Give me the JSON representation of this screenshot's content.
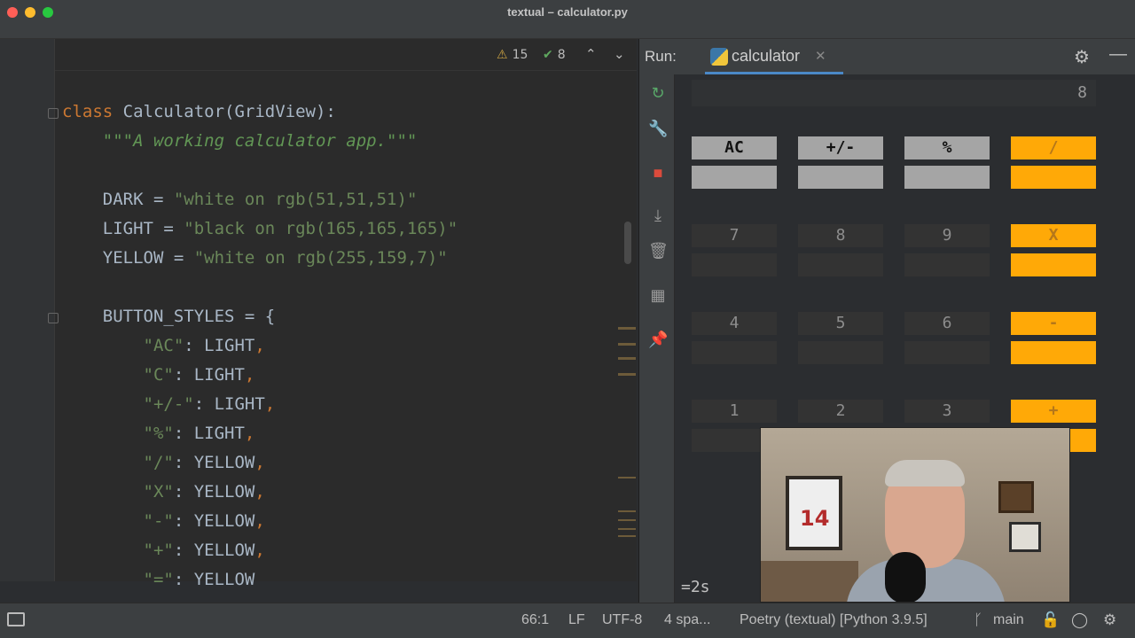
{
  "window": {
    "title": "textual – calculator.py"
  },
  "editor": {
    "inspection": {
      "warnings": "15",
      "weak_warnings": "8"
    },
    "code": [
      {
        "parts": [
          [
            "kw",
            "class "
          ],
          [
            "cls",
            "Calculator(GridView):"
          ]
        ]
      },
      {
        "parts": [
          [
            "doc",
            "    \"\"\"A working calculator app.\"\"\""
          ]
        ]
      },
      {
        "parts": []
      },
      {
        "parts": [
          [
            "cls",
            "    DARK = "
          ],
          [
            "str",
            "\"white on rgb(51,51,51)\""
          ]
        ]
      },
      {
        "parts": [
          [
            "cls",
            "    LIGHT = "
          ],
          [
            "str",
            "\"black on rgb(165,165,165)\""
          ]
        ]
      },
      {
        "parts": [
          [
            "cls",
            "    YELLOW = "
          ],
          [
            "str",
            "\"white on rgb(255,159,7)\""
          ]
        ]
      },
      {
        "parts": []
      },
      {
        "parts": [
          [
            "cls",
            "    BUTTON_STYLES = {"
          ]
        ]
      },
      {
        "parts": [
          [
            "str",
            "        \"AC\""
          ],
          [
            "cls",
            ": LIGHT"
          ],
          [
            "kw",
            ","
          ]
        ]
      },
      {
        "parts": [
          [
            "str",
            "        \"C\""
          ],
          [
            "cls",
            ": LIGHT"
          ],
          [
            "kw",
            ","
          ]
        ]
      },
      {
        "parts": [
          [
            "str",
            "        \"+/-\""
          ],
          [
            "cls",
            ": LIGHT"
          ],
          [
            "kw",
            ","
          ]
        ]
      },
      {
        "parts": [
          [
            "str",
            "        \"%\""
          ],
          [
            "cls",
            ": LIGHT"
          ],
          [
            "kw",
            ","
          ]
        ]
      },
      {
        "parts": [
          [
            "str",
            "        \"/\""
          ],
          [
            "cls",
            ": YELLOW"
          ],
          [
            "kw",
            ","
          ]
        ]
      },
      {
        "parts": [
          [
            "str",
            "        \"X\""
          ],
          [
            "cls",
            ": YELLOW"
          ],
          [
            "kw",
            ","
          ]
        ]
      },
      {
        "parts": [
          [
            "str",
            "        \"-\""
          ],
          [
            "cls",
            ": YELLOW"
          ],
          [
            "kw",
            ","
          ]
        ]
      },
      {
        "parts": [
          [
            "str",
            "        \"+\""
          ],
          [
            "cls",
            ": YELLOW"
          ],
          [
            "kw",
            ","
          ]
        ]
      },
      {
        "parts": [
          [
            "str",
            "        \"=\""
          ],
          [
            "cls",
            ": YELLOW"
          ]
        ]
      }
    ]
  },
  "run_panel": {
    "label": "Run:",
    "tab_name": "calculator",
    "display_value": "8",
    "elapsed": "=2s",
    "rows": [
      [
        {
          "label": "AC",
          "style": "light"
        },
        {
          "label": "+/-",
          "style": "light"
        },
        {
          "label": "%",
          "style": "light"
        },
        {
          "label": "/",
          "style": "yellow"
        }
      ],
      [
        {
          "label": "7",
          "style": "dark"
        },
        {
          "label": "8",
          "style": "dark"
        },
        {
          "label": "9",
          "style": "dark"
        },
        {
          "label": "X",
          "style": "yellow"
        }
      ],
      [
        {
          "label": "4",
          "style": "dark"
        },
        {
          "label": "5",
          "style": "dark"
        },
        {
          "label": "6",
          "style": "dark"
        },
        {
          "label": "-",
          "style": "yellow"
        }
      ],
      [
        {
          "label": "1",
          "style": "dark"
        },
        {
          "label": "2",
          "style": "dark"
        },
        {
          "label": "3",
          "style": "dark"
        },
        {
          "label": "+",
          "style": "yellow"
        }
      ]
    ]
  },
  "webcam": {
    "jersey_number": "14"
  },
  "statusbar": {
    "position": "66:1",
    "line_ending": "LF",
    "encoding": "UTF-8",
    "indent": "4 spa...",
    "interpreter": "Poetry (textual) [Python 3.9.5]",
    "branch": "main"
  },
  "colors": {
    "light_key": "#a5a5a5",
    "dark_key": "#333333",
    "yellow_key": "#ffa907",
    "accent": "#4a88c7"
  }
}
